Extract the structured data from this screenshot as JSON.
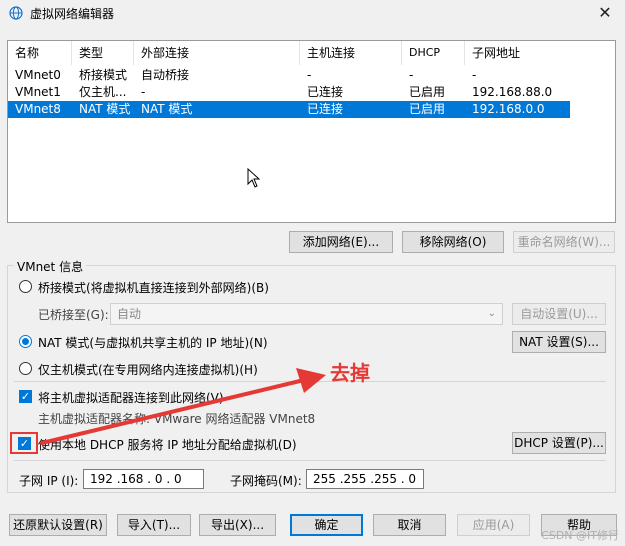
{
  "window": {
    "title": "虚拟网络编辑器",
    "close": "✕"
  },
  "list": {
    "headers": [
      "名称",
      "类型",
      "外部连接",
      "主机连接",
      "DHCP",
      "子网地址"
    ],
    "rows": [
      [
        "VMnet0",
        "桥接模式",
        "自动桥接",
        "-",
        "-",
        "-"
      ],
      [
        "VMnet1",
        "仅主机...",
        "-",
        "已连接",
        "已启用",
        "192.168.88.0"
      ],
      [
        "VMnet8",
        "NAT 模式",
        "NAT 模式",
        "已连接",
        "已启用",
        "192.168.0.0"
      ]
    ],
    "selected_row": 2
  },
  "list_buttons": {
    "add": "添加网络(E)...",
    "remove": "移除网络(O)",
    "rename": "重命名网络(W)..."
  },
  "vmnet_info": {
    "group_label": "VMnet 信息",
    "bridge_radio": "桥接模式(将虚拟机直接连接到外部网络)(B)",
    "bridged_to_label": "已桥接至(G):",
    "bridged_to_value": "自动",
    "auto_settings": "自动设置(U)...",
    "nat_radio": "NAT 模式(与虚拟机共享主机的 IP 地址)(N)",
    "nat_settings": "NAT 设置(S)...",
    "hostonly_radio": "仅主机模式(在专用网络内连接虚拟机)(H)",
    "connect_adapter": "将主机虚拟适配器连接到此网络(V)",
    "adapter_name": "主机虚拟适配器名称: VMware 网络适配器 VMnet8",
    "use_dhcp": "使用本地 DHCP 服务将 IP 地址分配给虚拟机(D)",
    "dhcp_settings": "DHCP 设置(P)...",
    "subnet_ip_label": "子网 IP (I):",
    "subnet_ip": "192 .168 . 0 . 0",
    "subnet_mask_label": "子网掩码(M):",
    "subnet_mask": "255 .255 .255 . 0"
  },
  "bottom_buttons": {
    "restore": "还原默认设置(R)",
    "import": "导入(T)...",
    "export": "导出(X)...",
    "ok": "确定",
    "cancel": "取消",
    "apply": "应用(A)",
    "help": "帮助"
  },
  "annotation": {
    "text": "去掉",
    "color": "#e53935"
  },
  "watermark": "CSDN @IT修行",
  "colors": {
    "selection": "#0078d7",
    "annotation": "#e53935"
  }
}
